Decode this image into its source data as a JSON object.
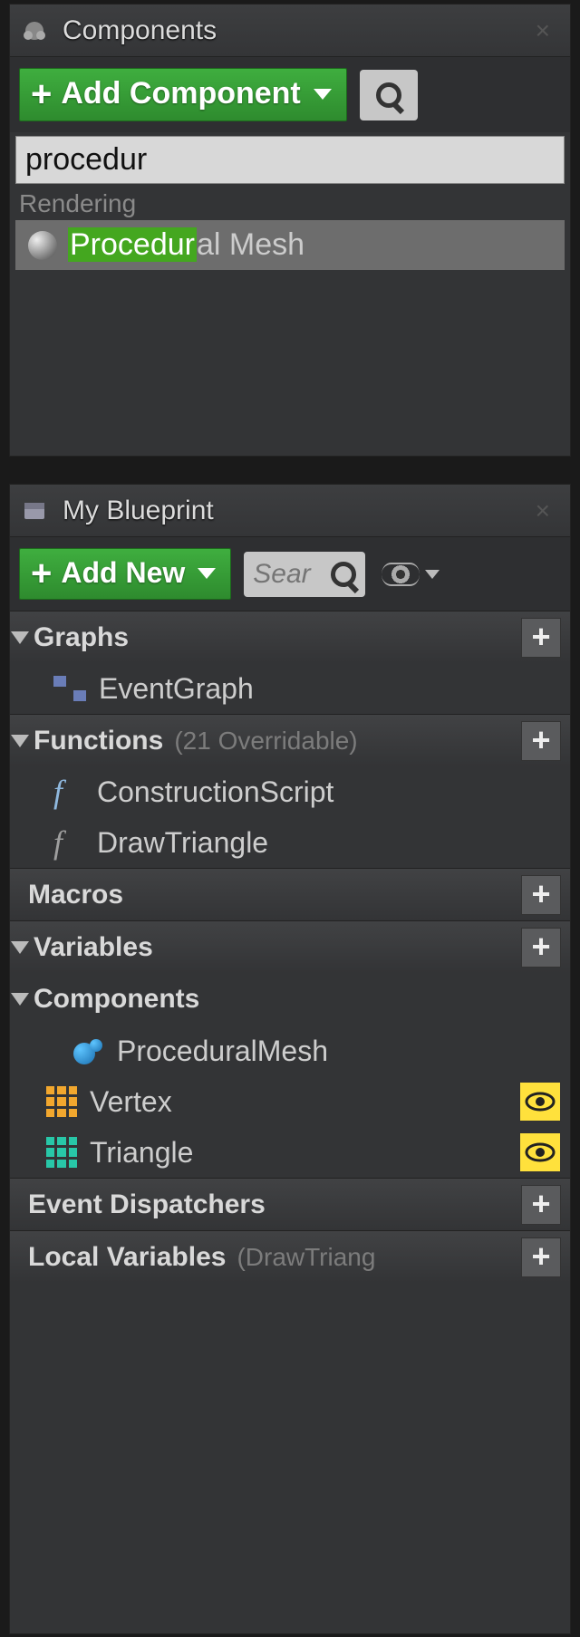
{
  "components": {
    "tab_title": "Components",
    "add_button": "Add Component",
    "search_value": "procedur",
    "category": "Rendering",
    "item_highlight": "Procedur",
    "item_rest": "al Mesh"
  },
  "blueprint": {
    "tab_title": "My Blueprint",
    "add_button": "Add New",
    "search_placeholder": "Sear",
    "sections": {
      "graphs": {
        "label": "Graphs"
      },
      "functions": {
        "label": "Functions",
        "sub": "(21 Overridable)"
      },
      "macros": {
        "label": "Macros"
      },
      "variables": {
        "label": "Variables"
      },
      "components": {
        "label": "Components"
      },
      "event_dispatchers": {
        "label": "Event Dispatchers"
      },
      "local_variables": {
        "label": "Local Variables",
        "sub": "(DrawTriang"
      }
    },
    "graphs_items": {
      "event_graph": "EventGraph"
    },
    "functions_items": {
      "construction": "ConstructionScript",
      "draw_triangle": "DrawTriangle"
    },
    "component_items": {
      "procedural_mesh": "ProceduralMesh",
      "vertex": "Vertex",
      "triangle": "Triangle"
    }
  }
}
